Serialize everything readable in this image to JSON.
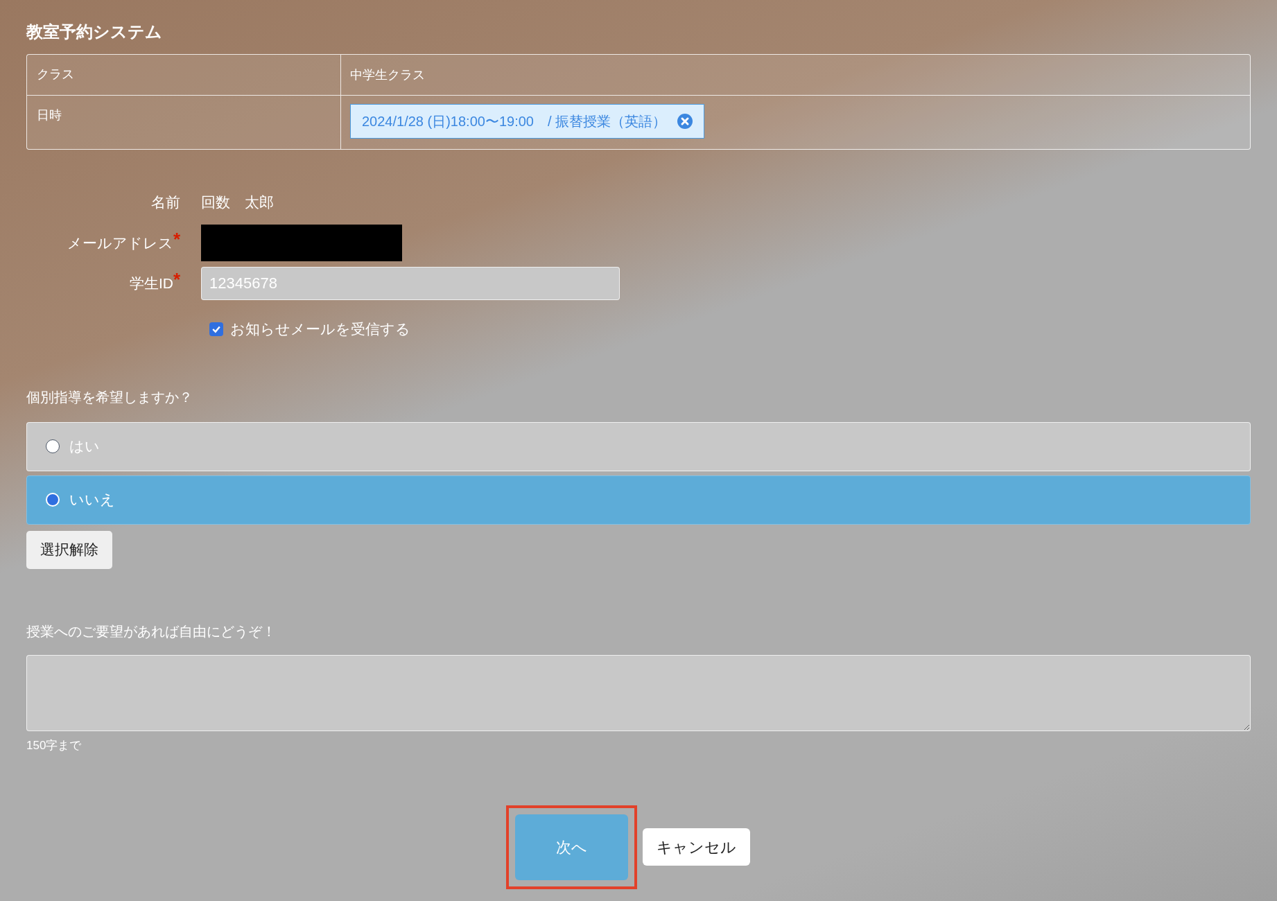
{
  "title": "教室予約システム",
  "summary_rows": [
    {
      "label": "クラス",
      "kind": "text",
      "value": "中学生クラス"
    },
    {
      "label": "日時",
      "kind": "tag",
      "value": "2024/1/28 (日)18:00〜19:00　/ 振替授業（英語）"
    }
  ],
  "required_mark": "*",
  "fields": [
    {
      "label": "名前",
      "required": false,
      "kind": "text",
      "value": "回数　太郎"
    },
    {
      "label": "メールアドレス",
      "required": true,
      "kind": "redacted"
    },
    {
      "label": "学生ID",
      "required": true,
      "kind": "input",
      "value": "12345678"
    }
  ],
  "newsletter": {
    "label": "お知らせメールを受信する",
    "checked": true
  },
  "question": "個別指導を希望しますか？",
  "options": [
    {
      "label": "はい",
      "selected": false
    },
    {
      "label": "いいえ",
      "selected": true
    }
  ],
  "clear_button": "選択解除",
  "comment": {
    "label": "授業へのご要望があれば自由にどうぞ！",
    "note": "150字まで"
  },
  "buttons": [
    {
      "label": "次へ",
      "kind": "primary",
      "highlighted": true
    },
    {
      "label": "キャンセル",
      "kind": "secondary",
      "highlighted": false
    }
  ]
}
